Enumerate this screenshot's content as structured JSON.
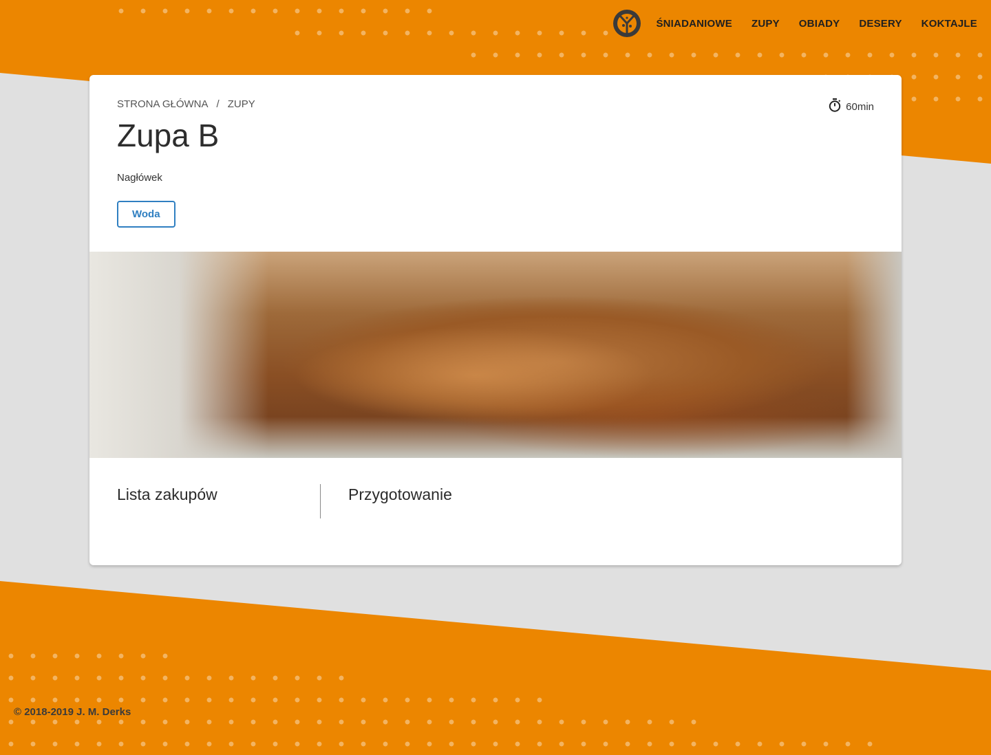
{
  "nav": {
    "logo_icon": "pizza-icon",
    "items": [
      {
        "label": "ŚNIADANIOWE"
      },
      {
        "label": "ZUPY"
      },
      {
        "label": "OBIADY"
      },
      {
        "label": "DESERY"
      },
      {
        "label": "KOKTAJLE"
      }
    ]
  },
  "breadcrumb": {
    "home": "STRONA GŁÓWNA",
    "separator": "/",
    "current": "ZUPY"
  },
  "recipe": {
    "time": "60min",
    "title": "Zupa B",
    "subtitle": "Nagłówek",
    "tag": "Woda",
    "image_alt": "breaded cutlets",
    "shopping_list_title": "Lista zakupów",
    "preparation_title": "Przygotowanie"
  },
  "footer": {
    "copyright": "© 2018-2019 J. M. Derks"
  },
  "colors": {
    "accent": "#ec8600",
    "background": "#e0e0e0",
    "tag_blue": "#2f7fc1"
  }
}
